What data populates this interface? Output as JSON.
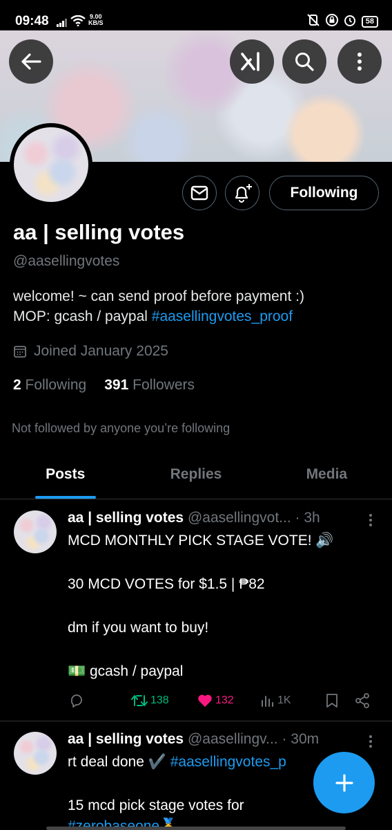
{
  "status_bar": {
    "time": "09:48",
    "speed_value": "9.00",
    "speed_unit": "KB/S",
    "battery": "58"
  },
  "profile": {
    "display_name": "aa | selling votes",
    "handle": "@aasellingvotes",
    "bio_line1": "welcome! ~ can send proof before payment :)",
    "bio_line2_text": "MOP: gcash / paypal ",
    "bio_line2_hashtag": "#aasellingvotes_proof",
    "joined": "Joined January 2025",
    "following_count": "2",
    "following_label": "Following",
    "followers_count": "391",
    "followers_label": "Followers",
    "mutual_note": "Not followed by anyone you’re following",
    "follow_button": "Following"
  },
  "tabs": [
    {
      "label": "Posts",
      "active": true
    },
    {
      "label": "Replies",
      "active": false
    },
    {
      "label": "Media",
      "active": false
    }
  ],
  "posts": [
    {
      "name": "aa | selling votes",
      "handle_time": " @aasellingvot... · 3h",
      "lines": [
        "MCD MONTHLY PICK STAGE VOTE! 🔊",
        "30 MCD VOTES for $1.5 | ₱82",
        "dm if you want to buy!",
        "💵 gcash / paypal"
      ],
      "retweets": "138",
      "likes": "132",
      "views": "1K"
    },
    {
      "name": "aa | selling votes",
      "handle_time": " @aasellingv... · 30m",
      "line1_text": "rt deal done ✔️ ",
      "line1_hashtag": "#aasellingvotes_p",
      "line2": "15 mcd pick stage votes for",
      "line3_hashtag": "#zerobaseone🥇"
    }
  ],
  "colors": {
    "accent": "#1d9bf0",
    "retweet": "#00ba7c",
    "like": "#f91880",
    "muted": "#71767b"
  }
}
